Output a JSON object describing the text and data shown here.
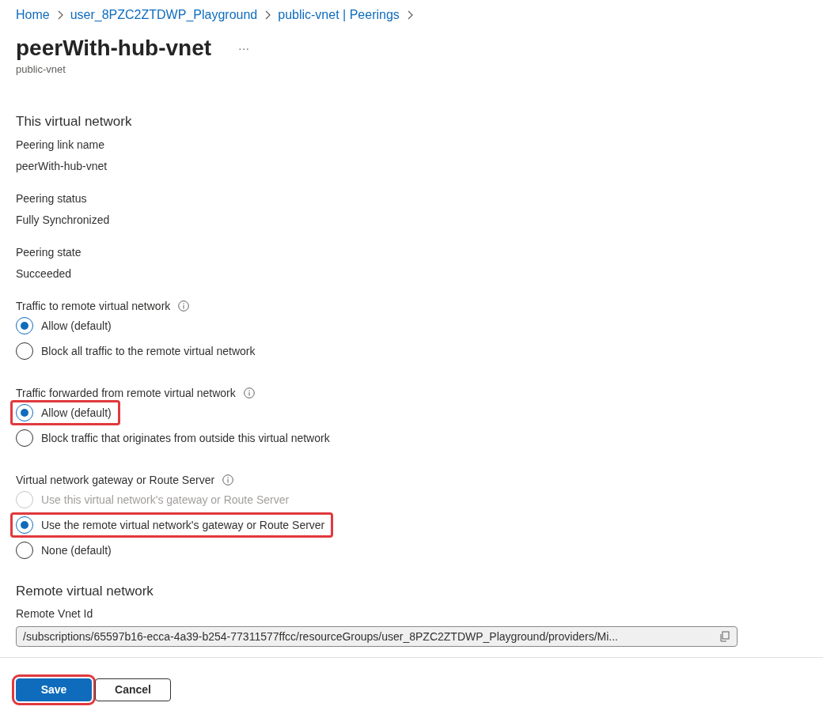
{
  "breadcrumb": [
    {
      "label": "Home"
    },
    {
      "label": "user_8PZC2ZTDWP_Playground"
    },
    {
      "label": "public-vnet | Peerings"
    }
  ],
  "title": "peerWith-hub-vnet",
  "more": "···",
  "subtitle": "public-vnet",
  "section": "This virtual network",
  "fields": [
    {
      "label": "Peering link name",
      "value": "peerWith-hub-vnet"
    },
    {
      "label": "Peering status",
      "value": "Fully Synchronized"
    },
    {
      "label": "Peering state",
      "value": "Succeeded"
    }
  ],
  "groups": [
    {
      "label": "Traffic to remote virtual network",
      "options": [
        {
          "label": "Allow (default)",
          "selected": true,
          "disabled": false,
          "highlighted": false
        },
        {
          "label": "Block all traffic to the remote virtual network",
          "selected": false,
          "disabled": false,
          "highlighted": false
        }
      ]
    },
    {
      "label": "Traffic forwarded from remote virtual network",
      "options": [
        {
          "label": "Allow (default)",
          "selected": true,
          "disabled": false,
          "highlighted": true
        },
        {
          "label": "Block traffic that originates from outside this virtual network",
          "selected": false,
          "disabled": false,
          "highlighted": false
        }
      ]
    },
    {
      "label": "Virtual network gateway or Route Server",
      "options": [
        {
          "label": "Use this virtual network's gateway or Route Server",
          "selected": false,
          "disabled": true,
          "highlighted": false
        },
        {
          "label": "Use the remote virtual network's gateway or Route Server",
          "selected": true,
          "disabled": false,
          "highlighted": true
        },
        {
          "label": "None (default)",
          "selected": false,
          "disabled": false,
          "highlighted": false
        }
      ]
    }
  ],
  "remote": {
    "heading": "Remote virtual network",
    "label": "Remote Vnet Id",
    "value": "/subscriptions/65597b16-ecca-4a39-b254-77311577ffcc/resourceGroups/user_8PZC2ZTDWP_Playground/providers/Mi..."
  },
  "buttons": [
    {
      "label": "Save",
      "kind": "primary",
      "highlighted": true
    },
    {
      "label": "Cancel",
      "kind": "secondary",
      "highlighted": false
    }
  ]
}
